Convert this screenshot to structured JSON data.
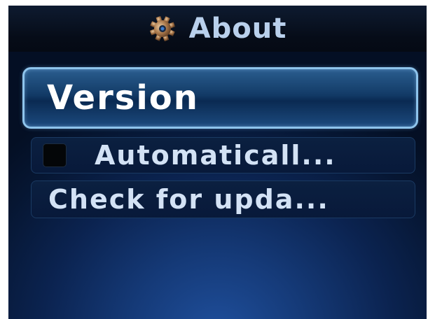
{
  "header": {
    "title": "About",
    "icon": "gear-icon"
  },
  "menu": {
    "items": [
      {
        "label": "Version",
        "selected": true
      },
      {
        "label": "Automaticall...",
        "checkbox": true,
        "checked": false
      },
      {
        "label": "Check for upda..."
      }
    ]
  },
  "colors": {
    "title_text": "#b9d0ec",
    "selected_border": "#8ec4ec",
    "background_top": "#040f24",
    "background_glow": "#1f4f9c"
  }
}
